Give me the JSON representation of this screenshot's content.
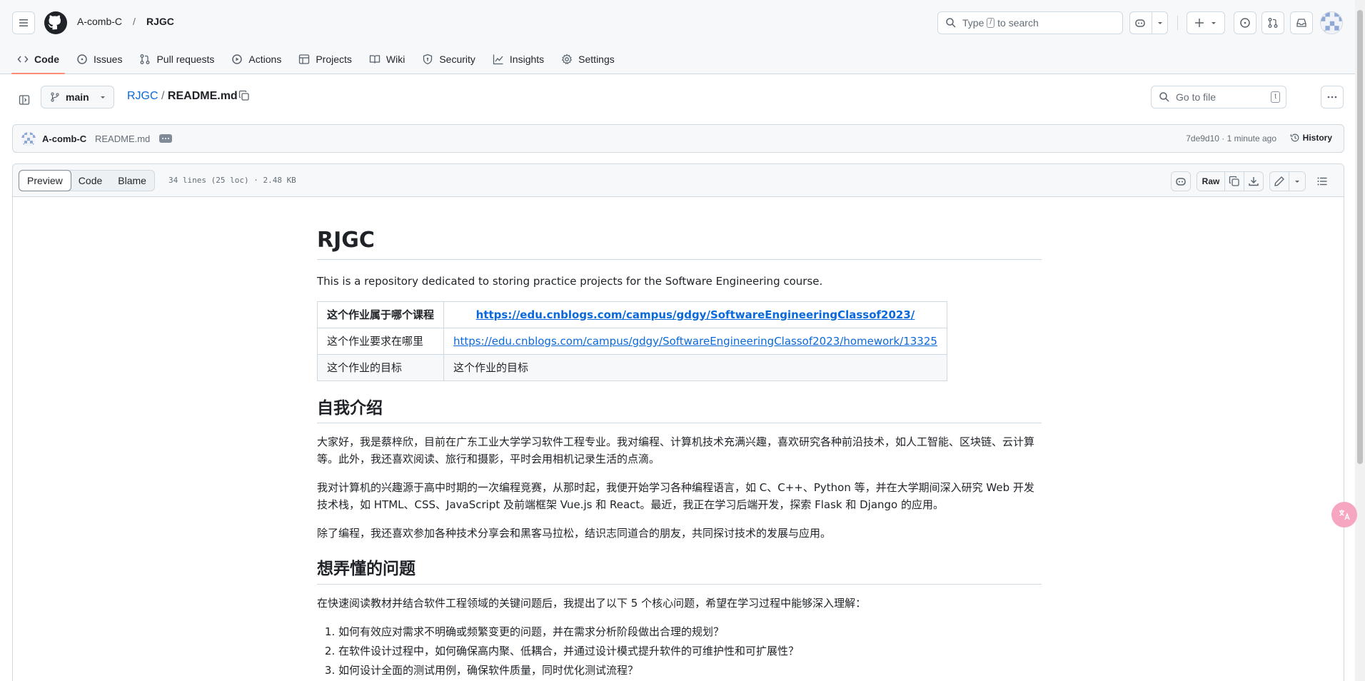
{
  "header": {
    "owner": "A-comb-C",
    "separator": "/",
    "repo": "RJGC",
    "search_prefix": "Type",
    "search_key": "/",
    "search_suffix": "to search"
  },
  "repo_nav": [
    {
      "label": "Code",
      "icon": "code-icon",
      "active": true
    },
    {
      "label": "Issues",
      "icon": "issue-opened-icon"
    },
    {
      "label": "Pull requests",
      "icon": "git-pull-request-icon"
    },
    {
      "label": "Actions",
      "icon": "play-icon"
    },
    {
      "label": "Projects",
      "icon": "table-icon"
    },
    {
      "label": "Wiki",
      "icon": "book-icon"
    },
    {
      "label": "Security",
      "icon": "shield-icon"
    },
    {
      "label": "Insights",
      "icon": "graph-icon"
    },
    {
      "label": "Settings",
      "icon": "gear-icon"
    }
  ],
  "file_header": {
    "branch": "main",
    "repo_link": "RJGC",
    "crumb_sep": "/",
    "file_name": "README.md",
    "goto_placeholder": "Go to file",
    "goto_key": "t"
  },
  "commit": {
    "author": "A-comb-C",
    "message": "README.md",
    "sha_time": "7de9d10 · 1 minute ago",
    "history": "History"
  },
  "file_toolbar": {
    "tabs": [
      "Preview",
      "Code",
      "Blame"
    ],
    "active_tab": "Preview",
    "meta": "34 lines (25 loc) · 2.48 KB",
    "raw": "Raw"
  },
  "readme": {
    "title": "RJGC",
    "intro": "This is a repository dedicated to storing practice projects for the Software Engineering course.",
    "table": {
      "header": [
        "这个作业属于哪个课程",
        "https://edu.cnblogs.com/campus/gdgy/SoftwareEngineeringClassof2023/"
      ],
      "rows": [
        [
          "这个作业要求在哪里",
          "https://edu.cnblogs.com/campus/gdgy/SoftwareEngineeringClassof2023/homework/13325"
        ],
        [
          "这个作业的目标",
          "这个作业的目标"
        ]
      ]
    },
    "h2_intro": "自我介绍",
    "p1": "大家好，我是蔡梓欣，目前在广东工业大学学习软件工程专业。我对编程、计算机技术充满兴趣，喜欢研究各种前沿技术，如人工智能、区块链、云计算等。此外，我还喜欢阅读、旅行和摄影，平时会用相机记录生活的点滴。",
    "p2": "我对计算机的兴趣源于高中时期的一次编程竞赛，从那时起，我便开始学习各种编程语言，如 C、C++、Python 等，并在大学期间深入研究 Web 开发技术栈，如 HTML、CSS、JavaScript 及前端框架 Vue.js 和 React。最近，我正在学习后端开发，探索 Flask 和 Django 的应用。",
    "p3": "除了编程，我还喜欢参加各种技术分享会和黑客马拉松，结识志同道合的朋友，共同探讨技术的发展与应用。",
    "h2_questions": "想弄懂的问题",
    "p4": "在快速阅读教材并结合软件工程领域的关键问题后，我提出了以下 5 个核心问题，希望在学习过程中能够深入理解：",
    "questions": [
      "如何有效应对需求不明确或频繁变更的问题，并在需求分析阶段做出合理的规划？",
      "在软件设计过程中，如何确保高内聚、低耦合，并通过设计模式提升软件的可维护性和可扩展性？",
      "如何设计全面的测试用例，确保软件质量，同时优化测试流程？"
    ]
  },
  "colors": {
    "accent": "#0969da",
    "active_underline": "#fd8c73",
    "border": "#d1d9e0",
    "muted": "#656d76"
  }
}
